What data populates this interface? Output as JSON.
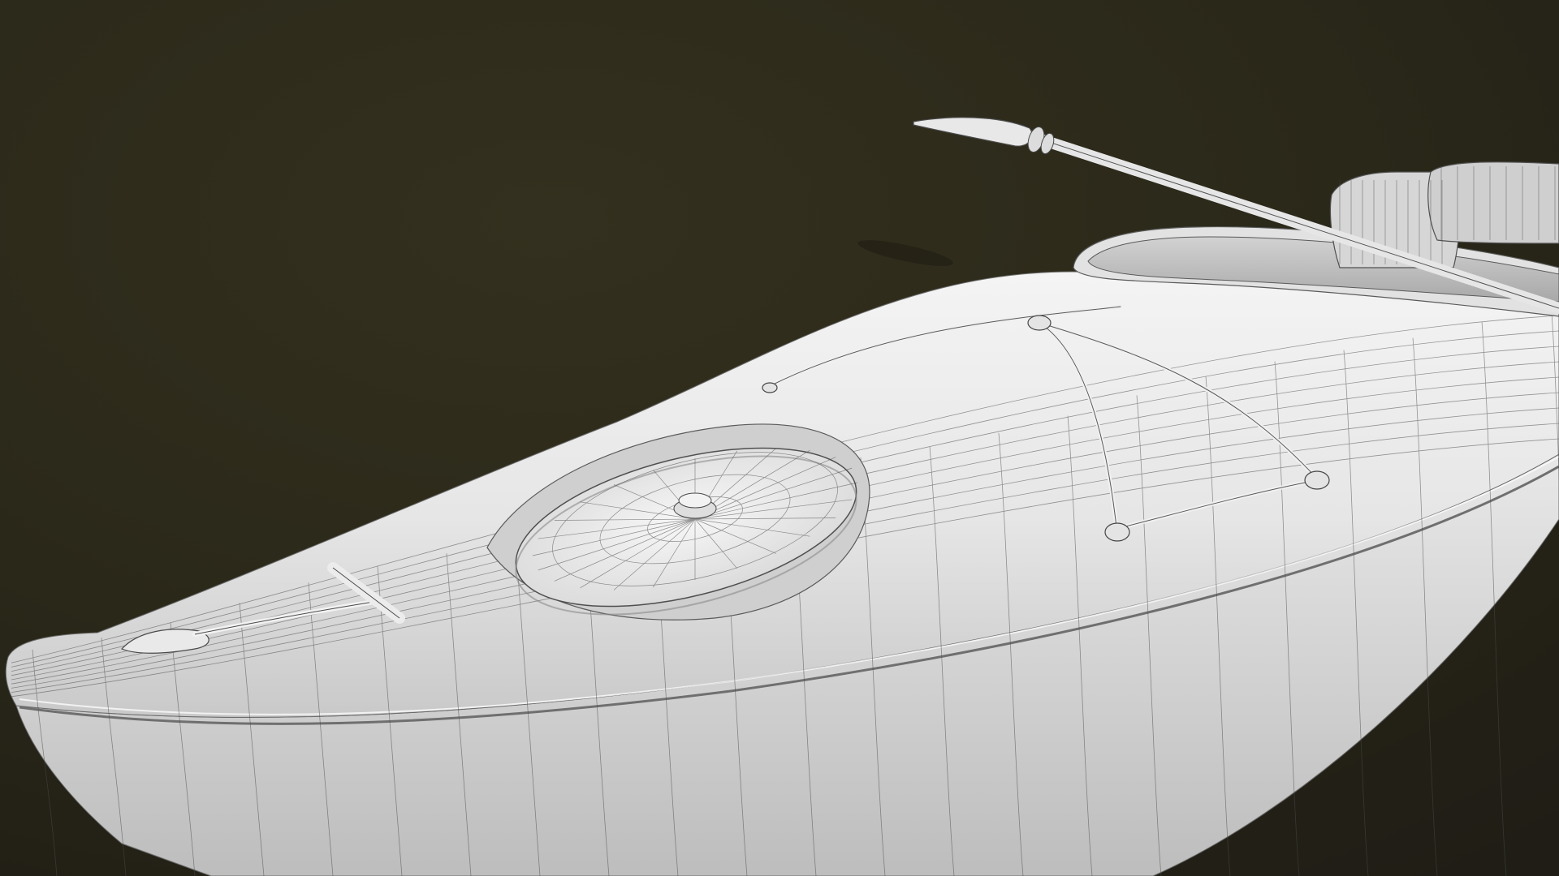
{
  "scene": {
    "subject": "kayak-wireframe-render",
    "colors": {
      "background_top": "#34301f",
      "background_mid": "#2a2819",
      "background_bottom": "#1f1d15",
      "hull_light": "#f2f2f2",
      "hull_mid": "#dcdcdc",
      "hull_shadow": "#a9a9a9",
      "wire": "#4a4a4a",
      "paddle": "#e6e6e6"
    }
  }
}
